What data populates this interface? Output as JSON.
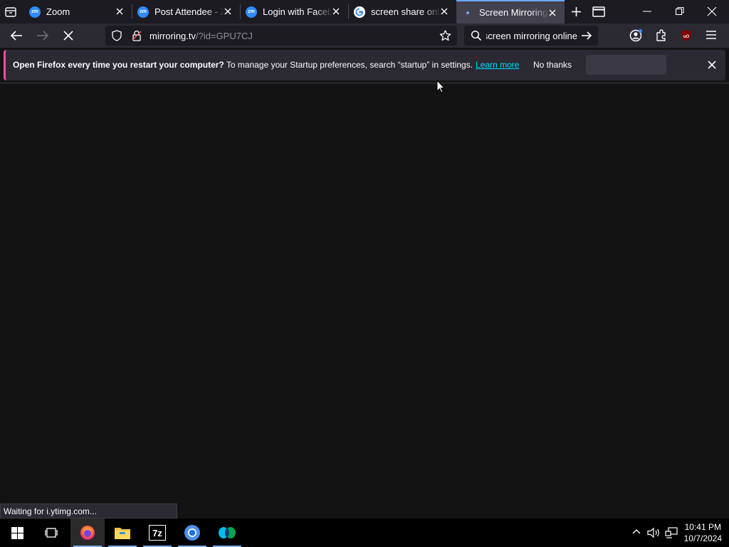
{
  "tabs": [
    {
      "title": "Zoom",
      "favicon": "zoom-icon",
      "favicon_text": "zm",
      "favicon_color": "#2d8cff",
      "active": false
    },
    {
      "title": "Post Attendee - Zo",
      "favicon": "zoom-icon",
      "favicon_text": "zm",
      "favicon_color": "#2d8cff",
      "active": false
    },
    {
      "title": "Login with Facebook",
      "favicon": "zoom-icon",
      "favicon_text": "zm",
      "favicon_color": "#2d8cff",
      "active": false
    },
    {
      "title": "screen share online",
      "favicon": "google-icon",
      "favicon_text": "G",
      "favicon_color": "#ffffff",
      "active": false
    },
    {
      "title": "Screen Mirroring A",
      "favicon": "loading-dot-icon",
      "favicon_text": "",
      "favicon_color": "#6aa9ff",
      "active": true
    }
  ],
  "navbar": {
    "url_host": "mirroring.tv",
    "url_path": "/?id=GPU7CJ",
    "search_text": "screen mirroring online"
  },
  "notice": {
    "bold": "Open Firefox every time you restart your computer?",
    "text": " To manage your Startup preferences, search “startup” in settings.",
    "link": "Learn more",
    "no_thanks": "No thanks"
  },
  "status": "Waiting for i.ytimg.com...",
  "taskbar": {
    "apps": [
      "firefox-icon",
      "file-explorer-icon",
      "7zip-icon",
      "chrome-icon",
      "webex-icon"
    ],
    "sevenzip_label": "7z",
    "time": "10:41 PM",
    "date": "10/7/2024"
  },
  "colors": {
    "accent": "#6aa9ff",
    "link": "#00ddff",
    "notice_bar": "#ff4aa2",
    "page_bg": "#141313"
  }
}
